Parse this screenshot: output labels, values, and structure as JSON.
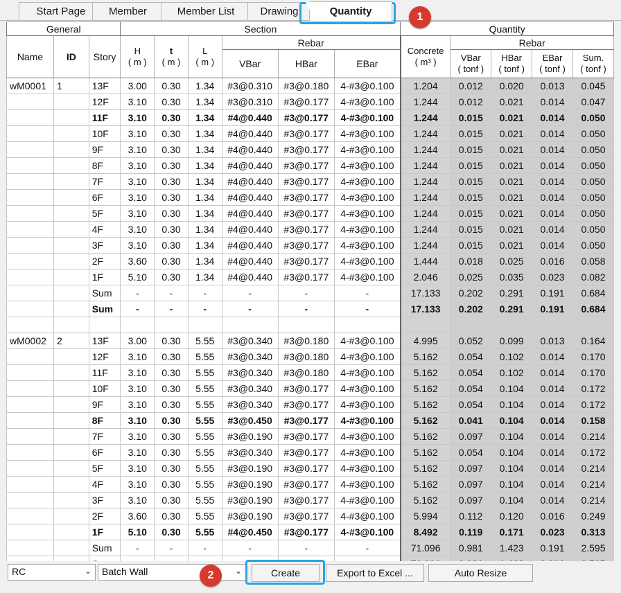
{
  "tabs": [
    {
      "label": "Start Page",
      "active": false
    },
    {
      "label": "Member",
      "active": false
    },
    {
      "label": "Member List",
      "active": false
    },
    {
      "label": "Drawing",
      "active": false
    },
    {
      "label": "Quantity",
      "active": true
    }
  ],
  "grid": {
    "groups": {
      "general": "General",
      "section": "Section",
      "quantity": "Quantity"
    },
    "sub": {
      "section_rebar": "Rebar",
      "quantity_rebar": "Rebar"
    },
    "cols": {
      "name": "Name",
      "id": "ID",
      "story": "Story",
      "h": "H",
      "h_unit": "( m )",
      "t": "t",
      "t_unit": "( m )",
      "l": "L",
      "l_unit": "( m )",
      "vbar": "VBar",
      "hbar": "HBar",
      "ebar": "EBar",
      "concrete": "Concrete",
      "concrete_unit": "( m³ )",
      "qvbar": "VBar",
      "qvbar_unit": "( tonf )",
      "qhbar": "HBar",
      "qhbar_unit": "( tonf )",
      "qebar": "EBar",
      "qebar_unit": "( tonf )",
      "qsum": "Sum.",
      "qsum_unit": "( tonf )"
    },
    "rows": [
      {
        "name": "wM0001",
        "id": "1",
        "story": "13F",
        "h": "3.00",
        "t": "0.30",
        "l": "1.34",
        "vbar": "#3@0.310",
        "hbar": "#3@0.180",
        "ebar": "4-#3@0.100",
        "conc": "1.204",
        "qv": "0.012",
        "qh": "0.020",
        "qe": "0.013",
        "qs": "0.045"
      },
      {
        "name": "",
        "id": "",
        "story": "12F",
        "h": "3.10",
        "t": "0.30",
        "l": "1.34",
        "vbar": "#3@0.310",
        "hbar": "#3@0.177",
        "ebar": "4-#3@0.100",
        "conc": "1.244",
        "qv": "0.012",
        "qh": "0.021",
        "qe": "0.014",
        "qs": "0.047"
      },
      {
        "name": "",
        "id": "",
        "story": "11F",
        "h": "3.10",
        "t": "0.30",
        "l": "1.34",
        "vbar": "#4@0.440",
        "hbar": "#3@0.177",
        "ebar": "4-#3@0.100",
        "conc": "1.244",
        "qv": "0.015",
        "qh": "0.021",
        "qe": "0.014",
        "qs": "0.050",
        "bold": true
      },
      {
        "name": "",
        "id": "",
        "story": "10F",
        "h": "3.10",
        "t": "0.30",
        "l": "1.34",
        "vbar": "#4@0.440",
        "hbar": "#3@0.177",
        "ebar": "4-#3@0.100",
        "conc": "1.244",
        "qv": "0.015",
        "qh": "0.021",
        "qe": "0.014",
        "qs": "0.050"
      },
      {
        "name": "",
        "id": "",
        "story": "9F",
        "h": "3.10",
        "t": "0.30",
        "l": "1.34",
        "vbar": "#4@0.440",
        "hbar": "#3@0.177",
        "ebar": "4-#3@0.100",
        "conc": "1.244",
        "qv": "0.015",
        "qh": "0.021",
        "qe": "0.014",
        "qs": "0.050"
      },
      {
        "name": "",
        "id": "",
        "story": "8F",
        "h": "3.10",
        "t": "0.30",
        "l": "1.34",
        "vbar": "#4@0.440",
        "hbar": "#3@0.177",
        "ebar": "4-#3@0.100",
        "conc": "1.244",
        "qv": "0.015",
        "qh": "0.021",
        "qe": "0.014",
        "qs": "0.050",
        "sep": true
      },
      {
        "name": "",
        "id": "",
        "story": "7F",
        "h": "3.10",
        "t": "0.30",
        "l": "1.34",
        "vbar": "#4@0.440",
        "hbar": "#3@0.177",
        "ebar": "4-#3@0.100",
        "conc": "1.244",
        "qv": "0.015",
        "qh": "0.021",
        "qe": "0.014",
        "qs": "0.050"
      },
      {
        "name": "",
        "id": "",
        "story": "6F",
        "h": "3.10",
        "t": "0.30",
        "l": "1.34",
        "vbar": "#4@0.440",
        "hbar": "#3@0.177",
        "ebar": "4-#3@0.100",
        "conc": "1.244",
        "qv": "0.015",
        "qh": "0.021",
        "qe": "0.014",
        "qs": "0.050"
      },
      {
        "name": "",
        "id": "",
        "story": "5F",
        "h": "3.10",
        "t": "0.30",
        "l": "1.34",
        "vbar": "#4@0.440",
        "hbar": "#3@0.177",
        "ebar": "4-#3@0.100",
        "conc": "1.244",
        "qv": "0.015",
        "qh": "0.021",
        "qe": "0.014",
        "qs": "0.050"
      },
      {
        "name": "",
        "id": "",
        "story": "4F",
        "h": "3.10",
        "t": "0.30",
        "l": "1.34",
        "vbar": "#4@0.440",
        "hbar": "#3@0.177",
        "ebar": "4-#3@0.100",
        "conc": "1.244",
        "qv": "0.015",
        "qh": "0.021",
        "qe": "0.014",
        "qs": "0.050"
      },
      {
        "name": "",
        "id": "",
        "story": "3F",
        "h": "3.10",
        "t": "0.30",
        "l": "1.34",
        "vbar": "#4@0.440",
        "hbar": "#3@0.177",
        "ebar": "4-#3@0.100",
        "conc": "1.244",
        "qv": "0.015",
        "qh": "0.021",
        "qe": "0.014",
        "qs": "0.050"
      },
      {
        "name": "",
        "id": "",
        "story": "2F",
        "h": "3.60",
        "t": "0.30",
        "l": "1.34",
        "vbar": "#4@0.440",
        "hbar": "#3@0.177",
        "ebar": "4-#3@0.100",
        "conc": "1.444",
        "qv": "0.018",
        "qh": "0.025",
        "qe": "0.016",
        "qs": "0.058"
      },
      {
        "name": "",
        "id": "",
        "story": "1F",
        "h": "5.10",
        "t": "0.30",
        "l": "1.34",
        "vbar": "#4@0.440",
        "hbar": "#3@0.177",
        "ebar": "4-#3@0.100",
        "conc": "2.046",
        "qv": "0.025",
        "qh": "0.035",
        "qe": "0.023",
        "qs": "0.082",
        "sep": true
      },
      {
        "name": "",
        "id": "",
        "story": "Sum",
        "h": "-",
        "t": "-",
        "l": "-",
        "vbar": "-",
        "hbar": "-",
        "ebar": "-",
        "conc": "17.133",
        "qv": "0.202",
        "qh": "0.291",
        "qe": "0.191",
        "qs": "0.684"
      },
      {
        "name": "",
        "id": "",
        "story": "Sum",
        "h": "-",
        "t": "-",
        "l": "-",
        "vbar": "-",
        "hbar": "-",
        "ebar": "-",
        "conc": "17.133",
        "qv": "0.202",
        "qh": "0.291",
        "qe": "0.191",
        "qs": "0.684",
        "bold": true
      },
      {
        "blank": true
      },
      {
        "name": "wM0002",
        "id": "2",
        "story": "13F",
        "h": "3.00",
        "t": "0.30",
        "l": "5.55",
        "vbar": "#3@0.340",
        "hbar": "#3@0.180",
        "ebar": "4-#3@0.100",
        "conc": "4.995",
        "qv": "0.052",
        "qh": "0.099",
        "qe": "0.013",
        "qs": "0.164"
      },
      {
        "name": "",
        "id": "",
        "story": "12F",
        "h": "3.10",
        "t": "0.30",
        "l": "5.55",
        "vbar": "#3@0.340",
        "hbar": "#3@0.180",
        "ebar": "4-#3@0.100",
        "conc": "5.162",
        "qv": "0.054",
        "qh": "0.102",
        "qe": "0.014",
        "qs": "0.170"
      },
      {
        "name": "",
        "id": "",
        "story": "11F",
        "h": "3.10",
        "t": "0.30",
        "l": "5.55",
        "vbar": "#3@0.340",
        "hbar": "#3@0.180",
        "ebar": "4-#3@0.100",
        "conc": "5.162",
        "qv": "0.054",
        "qh": "0.102",
        "qe": "0.014",
        "qs": "0.170"
      },
      {
        "name": "",
        "id": "",
        "story": "10F",
        "h": "3.10",
        "t": "0.30",
        "l": "5.55",
        "vbar": "#3@0.340",
        "hbar": "#3@0.177",
        "ebar": "4-#3@0.100",
        "conc": "5.162",
        "qv": "0.054",
        "qh": "0.104",
        "qe": "0.014",
        "qs": "0.172"
      },
      {
        "name": "",
        "id": "",
        "story": "9F",
        "h": "3.10",
        "t": "0.30",
        "l": "5.55",
        "vbar": "#3@0.340",
        "hbar": "#3@0.177",
        "ebar": "4-#3@0.100",
        "conc": "5.162",
        "qv": "0.054",
        "qh": "0.104",
        "qe": "0.014",
        "qs": "0.172"
      },
      {
        "name": "",
        "id": "",
        "story": "8F",
        "h": "3.10",
        "t": "0.30",
        "l": "5.55",
        "vbar": "#3@0.450",
        "hbar": "#3@0.177",
        "ebar": "4-#3@0.100",
        "conc": "5.162",
        "qv": "0.041",
        "qh": "0.104",
        "qe": "0.014",
        "qs": "0.158",
        "bold": true
      },
      {
        "name": "",
        "id": "",
        "story": "7F",
        "h": "3.10",
        "t": "0.30",
        "l": "5.55",
        "vbar": "#3@0.190",
        "hbar": "#3@0.177",
        "ebar": "4-#3@0.100",
        "conc": "5.162",
        "qv": "0.097",
        "qh": "0.104",
        "qe": "0.014",
        "qs": "0.214"
      },
      {
        "name": "",
        "id": "",
        "story": "6F",
        "h": "3.10",
        "t": "0.30",
        "l": "5.55",
        "vbar": "#3@0.340",
        "hbar": "#3@0.177",
        "ebar": "4-#3@0.100",
        "conc": "5.162",
        "qv": "0.054",
        "qh": "0.104",
        "qe": "0.014",
        "qs": "0.172"
      },
      {
        "name": "",
        "id": "",
        "story": "5F",
        "h": "3.10",
        "t": "0.30",
        "l": "5.55",
        "vbar": "#3@0.190",
        "hbar": "#3@0.177",
        "ebar": "4-#3@0.100",
        "conc": "5.162",
        "qv": "0.097",
        "qh": "0.104",
        "qe": "0.014",
        "qs": "0.214",
        "sep": true
      },
      {
        "name": "",
        "id": "",
        "story": "4F",
        "h": "3.10",
        "t": "0.30",
        "l": "5.55",
        "vbar": "#3@0.190",
        "hbar": "#3@0.177",
        "ebar": "4-#3@0.100",
        "conc": "5.162",
        "qv": "0.097",
        "qh": "0.104",
        "qe": "0.014",
        "qs": "0.214"
      },
      {
        "name": "",
        "id": "",
        "story": "3F",
        "h": "3.10",
        "t": "0.30",
        "l": "5.55",
        "vbar": "#3@0.190",
        "hbar": "#3@0.177",
        "ebar": "4-#3@0.100",
        "conc": "5.162",
        "qv": "0.097",
        "qh": "0.104",
        "qe": "0.014",
        "qs": "0.214"
      },
      {
        "name": "",
        "id": "",
        "story": "2F",
        "h": "3.60",
        "t": "0.30",
        "l": "5.55",
        "vbar": "#3@0.190",
        "hbar": "#3@0.177",
        "ebar": "4-#3@0.100",
        "conc": "5.994",
        "qv": "0.112",
        "qh": "0.120",
        "qe": "0.016",
        "qs": "0.249"
      },
      {
        "name": "",
        "id": "",
        "story": "1F",
        "h": "5.10",
        "t": "0.30",
        "l": "5.55",
        "vbar": "#4@0.450",
        "hbar": "#3@0.177",
        "ebar": "4-#3@0.100",
        "conc": "8.492",
        "qv": "0.119",
        "qh": "0.171",
        "qe": "0.023",
        "qs": "0.313",
        "bold": true
      },
      {
        "name": "",
        "id": "",
        "story": "Sum",
        "h": "-",
        "t": "-",
        "l": "-",
        "vbar": "-",
        "hbar": "-",
        "ebar": "-",
        "conc": "71.096",
        "qv": "0.981",
        "qh": "1.423",
        "qe": "0.191",
        "qs": "2.595",
        "sep": true
      },
      {
        "name": "",
        "id": "",
        "story": "Sum",
        "h": "-",
        "t": "-",
        "l": "-",
        "vbar": "-",
        "hbar": "-",
        "ebar": "-",
        "conc": "71.096",
        "qv": "0.981",
        "qh": "1.423",
        "qe": "0.191",
        "qs": "2.595",
        "bold": true
      }
    ]
  },
  "bottom": {
    "material_select": "RC",
    "type_select": "Batch Wall",
    "create_label": "Create",
    "export_label": "Export to Excel ...",
    "autoresize_label": "Auto Resize"
  },
  "annotations": {
    "badge1": "1",
    "badge2": "2",
    "highlight_color": "#2aa3e0",
    "badge_color": "#d63a2d"
  }
}
